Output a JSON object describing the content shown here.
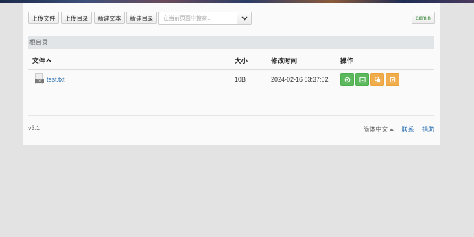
{
  "toolbar": {
    "upload_file": "上传文件",
    "upload_dir": "上传目录",
    "new_text": "新建文本",
    "new_dir": "新建目录",
    "search_placeholder": "在当前页面中搜索...",
    "user": "admin"
  },
  "breadcrumb": {
    "root": "根目录"
  },
  "table": {
    "headers": {
      "file": "文件",
      "size": "大小",
      "modified": "修改时间",
      "actions": "操作"
    },
    "rows": [
      {
        "name": "test.txt",
        "icon_tag": "TXT",
        "size": "10B",
        "modified": "2024-02-16 03:37:02"
      }
    ]
  },
  "footer": {
    "version": "v3.1",
    "language": "简体中文",
    "contact": "联系",
    "donate": "捐助"
  },
  "colors": {
    "success": "#5cb85c",
    "warning": "#f0ad4e",
    "link": "#2a6fb0"
  }
}
